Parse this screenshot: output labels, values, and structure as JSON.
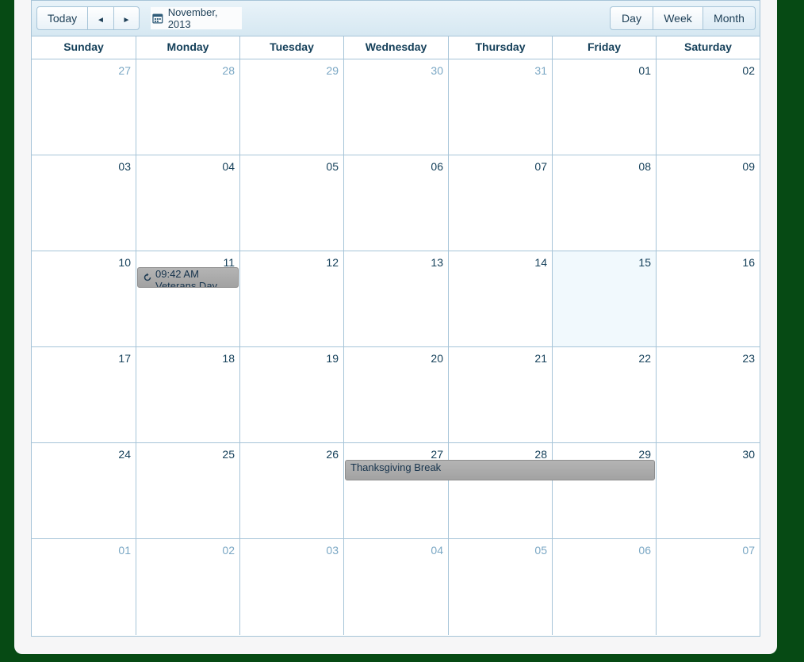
{
  "toolbar": {
    "today_label": "Today",
    "prev_icon": "◄",
    "next_icon": "►",
    "date_label": "November, 2013",
    "views": [
      "Day",
      "Week",
      "Month"
    ],
    "active_view": "Month"
  },
  "days_of_week": [
    "Sunday",
    "Monday",
    "Tuesday",
    "Wednesday",
    "Thursday",
    "Friday",
    "Saturday"
  ],
  "weeks": [
    [
      {
        "d": "27",
        "other": true
      },
      {
        "d": "28",
        "other": true
      },
      {
        "d": "29",
        "other": true
      },
      {
        "d": "30",
        "other": true
      },
      {
        "d": "31",
        "other": true
      },
      {
        "d": "01"
      },
      {
        "d": "02"
      }
    ],
    [
      {
        "d": "03"
      },
      {
        "d": "04"
      },
      {
        "d": "05"
      },
      {
        "d": "06"
      },
      {
        "d": "07"
      },
      {
        "d": "08"
      },
      {
        "d": "09"
      }
    ],
    [
      {
        "d": "10"
      },
      {
        "d": "11"
      },
      {
        "d": "12"
      },
      {
        "d": "13"
      },
      {
        "d": "14"
      },
      {
        "d": "15",
        "today": true
      },
      {
        "d": "16"
      }
    ],
    [
      {
        "d": "17"
      },
      {
        "d": "18"
      },
      {
        "d": "19"
      },
      {
        "d": "20"
      },
      {
        "d": "21"
      },
      {
        "d": "22"
      },
      {
        "d": "23"
      }
    ],
    [
      {
        "d": "24"
      },
      {
        "d": "25"
      },
      {
        "d": "26"
      },
      {
        "d": "27"
      },
      {
        "d": "28"
      },
      {
        "d": "29"
      },
      {
        "d": "30"
      }
    ],
    [
      {
        "d": "01",
        "other": true
      },
      {
        "d": "02",
        "other": true
      },
      {
        "d": "03",
        "other": true
      },
      {
        "d": "04",
        "other": true
      },
      {
        "d": "05",
        "other": true
      },
      {
        "d": "06",
        "other": true
      },
      {
        "d": "07",
        "other": true
      }
    ]
  ],
  "appointments": {
    "veterans": {
      "time": "09:42 AM",
      "title": "Veterans Day",
      "recurring": true
    },
    "thanksgiving": {
      "title": "Thanksgiving Break"
    }
  },
  "colors": {
    "border": "#a6c4d8",
    "text": "#15405a",
    "other_month": "#7aa7c4",
    "today_bg": "#f1f9fd",
    "appointment": "#a8a8a8",
    "page_bg": "#064a14"
  }
}
